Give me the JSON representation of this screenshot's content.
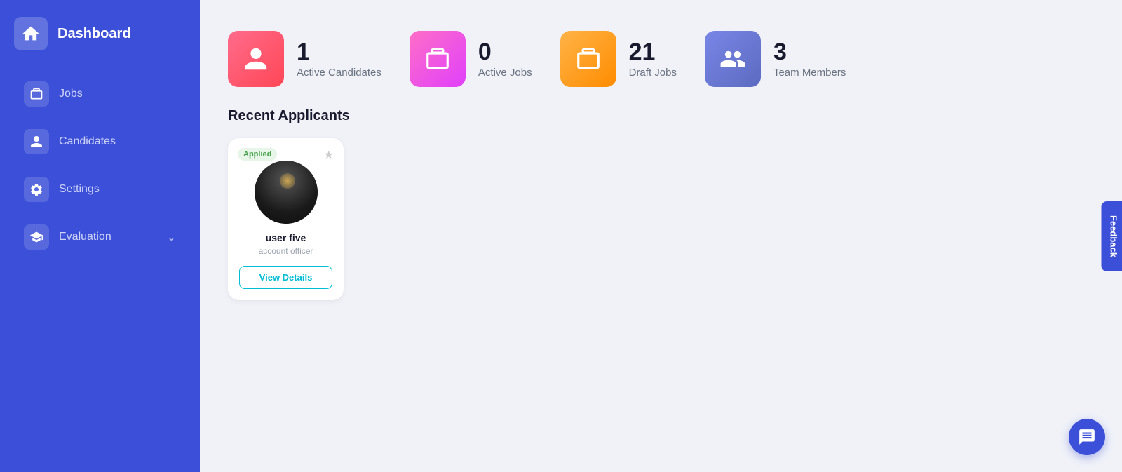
{
  "sidebar": {
    "logo_text": "Dashboard",
    "items": [
      {
        "id": "dashboard",
        "label": "Dashboard",
        "active": true
      },
      {
        "id": "jobs",
        "label": "Jobs",
        "active": false
      },
      {
        "id": "candidates",
        "label": "Candidates",
        "active": false
      },
      {
        "id": "settings",
        "label": "Settings",
        "active": false
      },
      {
        "id": "evaluation",
        "label": "Evaluation",
        "active": false,
        "has_chevron": true
      }
    ]
  },
  "stats": [
    {
      "id": "active-candidates",
      "number": "1",
      "label": "Active Candidates",
      "gradient": "pink"
    },
    {
      "id": "active-jobs",
      "number": "0",
      "label": "Active Jobs",
      "gradient": "magenta"
    },
    {
      "id": "draft-jobs",
      "number": "21",
      "label": "Draft Jobs",
      "gradient": "orange"
    },
    {
      "id": "team-members",
      "number": "3",
      "label": "Team Members",
      "gradient": "blue"
    }
  ],
  "recent_applicants": {
    "title": "Recent Applicants",
    "applicants": [
      {
        "id": "user-five",
        "badge": "Applied",
        "name": "user five",
        "role": "account officer",
        "view_details_label": "View Details"
      }
    ]
  },
  "feedback_label": "Feedback",
  "chat_icon": "chat-icon"
}
